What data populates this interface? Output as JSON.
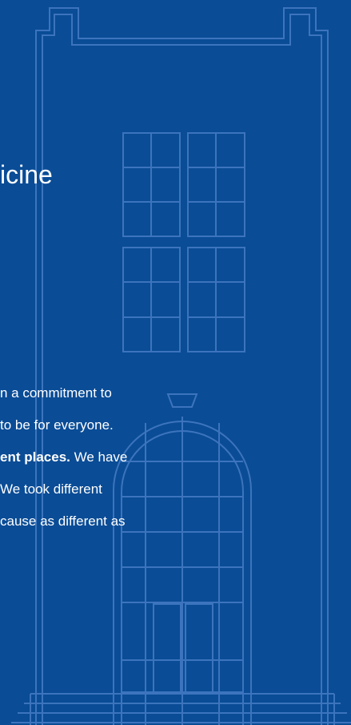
{
  "heading": "icine",
  "paragraph": {
    "lines": [
      {
        "text": "n a commitment to"
      },
      {
        "text": "to be for everyone."
      },
      {
        "bold": "ent places.",
        "text": " We have"
      },
      {
        "text": "We took different"
      },
      {
        "text": "cause as different as"
      }
    ]
  },
  "colors": {
    "background": "#0a4c96",
    "line_art": "#3c74bd",
    "text": "#ffffff"
  }
}
